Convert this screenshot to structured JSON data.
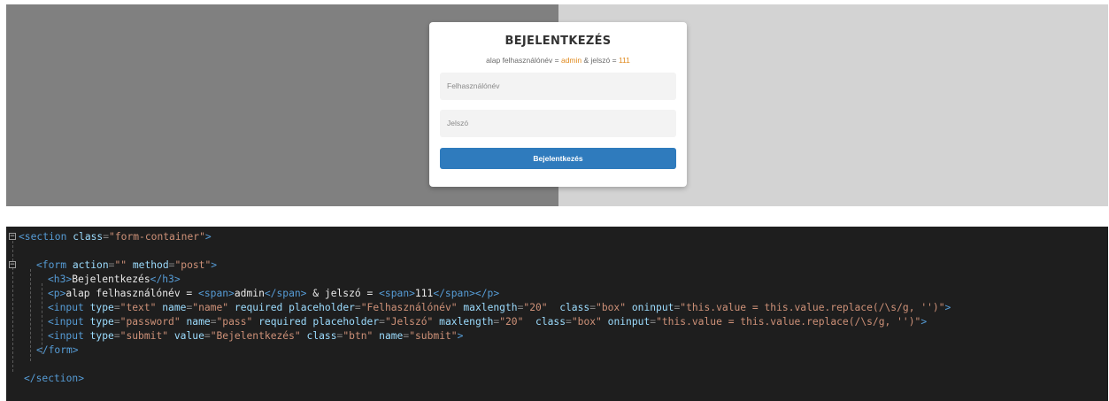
{
  "preview": {
    "title": "BEJELENTKEZÉS",
    "hint_prefix": "alap felhasználónév = ",
    "hint_user": "admin",
    "hint_mid": " & jelszó = ",
    "hint_pass": "111",
    "username_placeholder": "Felhasználónév",
    "password_placeholder": "Jelszó",
    "submit_label": "Bejelentkezés",
    "colors": {
      "left_bg": "#808080",
      "right_bg": "#d3d3d3",
      "highlight": "#e08a1e",
      "button": "#2f7bbd"
    }
  },
  "code": {
    "lines": [
      [
        [
          "tag",
          "<section "
        ],
        [
          "attr",
          "class"
        ],
        [
          "pun",
          "="
        ],
        [
          "str",
          "\"form-container\""
        ],
        [
          "tag",
          ">"
        ]
      ],
      [],
      [
        [
          "tag",
          "<form "
        ],
        [
          "attr",
          "action"
        ],
        [
          "pun",
          "="
        ],
        [
          "str",
          "\"\" "
        ],
        [
          "attr",
          "method"
        ],
        [
          "pun",
          "="
        ],
        [
          "str",
          "\"post\""
        ],
        [
          "tag",
          ">"
        ]
      ],
      [
        [
          "tag",
          "<h3>"
        ],
        [
          "txt",
          "Bejelentkezés"
        ],
        [
          "tag",
          "</h3>"
        ]
      ],
      [
        [
          "tag",
          "<p>"
        ],
        [
          "txt",
          "alap felhasználónév = "
        ],
        [
          "tag",
          "<span>"
        ],
        [
          "txt",
          "admin"
        ],
        [
          "tag",
          "</span>"
        ],
        [
          "txt",
          " & jelszó = "
        ],
        [
          "tag",
          "<span>"
        ],
        [
          "txt",
          "111"
        ],
        [
          "tag",
          "</span></p>"
        ]
      ],
      [
        [
          "tag",
          "<input "
        ],
        [
          "attr",
          "type"
        ],
        [
          "pun",
          "="
        ],
        [
          "str",
          "\"text\" "
        ],
        [
          "attr",
          "name"
        ],
        [
          "pun",
          "="
        ],
        [
          "str",
          "\"name\" "
        ],
        [
          "attr",
          "required placeholder"
        ],
        [
          "pun",
          "="
        ],
        [
          "str",
          "\"Felhasználónév\" "
        ],
        [
          "attr",
          "maxlength"
        ],
        [
          "pun",
          "="
        ],
        [
          "str",
          "\"20\"  "
        ],
        [
          "attr",
          "class"
        ],
        [
          "pun",
          "="
        ],
        [
          "str",
          "\"box\" "
        ],
        [
          "attr",
          "oninput"
        ],
        [
          "pun",
          "="
        ],
        [
          "str",
          "\"this.value = this.value.replace(/\\s/g, '')\""
        ],
        [
          "tag",
          ">"
        ]
      ],
      [
        [
          "tag",
          "<input "
        ],
        [
          "attr",
          "type"
        ],
        [
          "pun",
          "="
        ],
        [
          "str",
          "\"password\" "
        ],
        [
          "attr",
          "name"
        ],
        [
          "pun",
          "="
        ],
        [
          "str",
          "\"pass\" "
        ],
        [
          "attr",
          "required placeholder"
        ],
        [
          "pun",
          "="
        ],
        [
          "str",
          "\"Jelszó\" "
        ],
        [
          "attr",
          "maxlength"
        ],
        [
          "pun",
          "="
        ],
        [
          "str",
          "\"20\"  "
        ],
        [
          "attr",
          "class"
        ],
        [
          "pun",
          "="
        ],
        [
          "str",
          "\"box\" "
        ],
        [
          "attr",
          "oninput"
        ],
        [
          "pun",
          "="
        ],
        [
          "str",
          "\"this.value = this.value.replace(/\\s/g, '')\""
        ],
        [
          "tag",
          ">"
        ]
      ],
      [
        [
          "tag",
          "<input "
        ],
        [
          "attr",
          "type"
        ],
        [
          "pun",
          "="
        ],
        [
          "str",
          "\"submit\" "
        ],
        [
          "attr",
          "value"
        ],
        [
          "pun",
          "="
        ],
        [
          "str",
          "\"Bejelentkezés\" "
        ],
        [
          "attr",
          "class"
        ],
        [
          "pun",
          "="
        ],
        [
          "str",
          "\"btn\" "
        ],
        [
          "attr",
          "name"
        ],
        [
          "pun",
          "="
        ],
        [
          "str",
          "\"submit\""
        ],
        [
          "tag",
          ">"
        ]
      ],
      [
        [
          "tag",
          "</form>"
        ]
      ],
      [],
      [
        [
          "tag",
          "</section>"
        ]
      ]
    ],
    "colors": {
      "background": "#1e1e1e",
      "tag": "#569cd6",
      "attribute": "#9cdcfe",
      "string": "#ce9178",
      "text": "#e8e8e8"
    }
  }
}
